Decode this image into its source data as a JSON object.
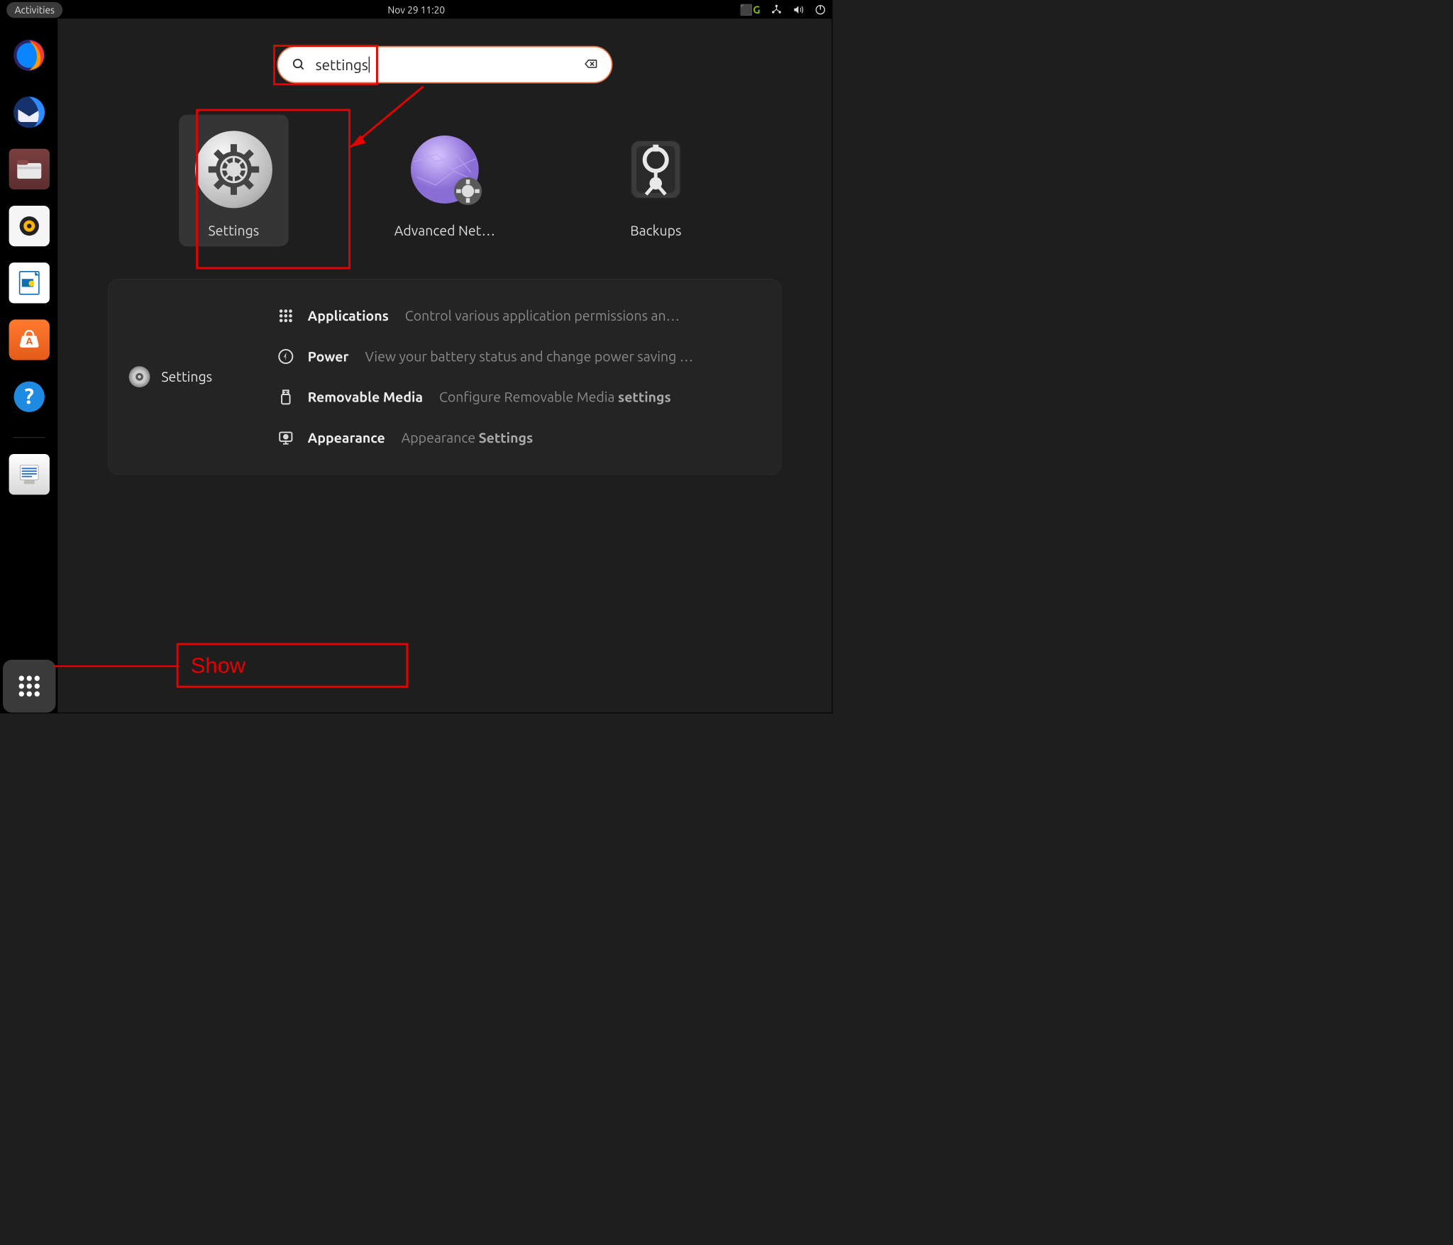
{
  "topbar": {
    "activities": "Activities",
    "datetime": "Nov 29  11:20"
  },
  "search": {
    "value": "settings"
  },
  "results": [
    {
      "label": "Settings"
    },
    {
      "label": "Advanced Net…"
    },
    {
      "label": "Backups"
    }
  ],
  "category": {
    "heading": "Settings",
    "rows": [
      {
        "label": "Applications",
        "desc": "Control various application permissions an…"
      },
      {
        "label": "Power",
        "desc": "View your battery status and change power saving …"
      },
      {
        "label": "Removable Media",
        "desc": "Configure Removable Media ",
        "desc_bold": "settings"
      },
      {
        "label": "Appearance",
        "desc": "Appearance ",
        "desc_bold": "Settings"
      }
    ]
  },
  "annotations": {
    "show_label": "Show"
  }
}
